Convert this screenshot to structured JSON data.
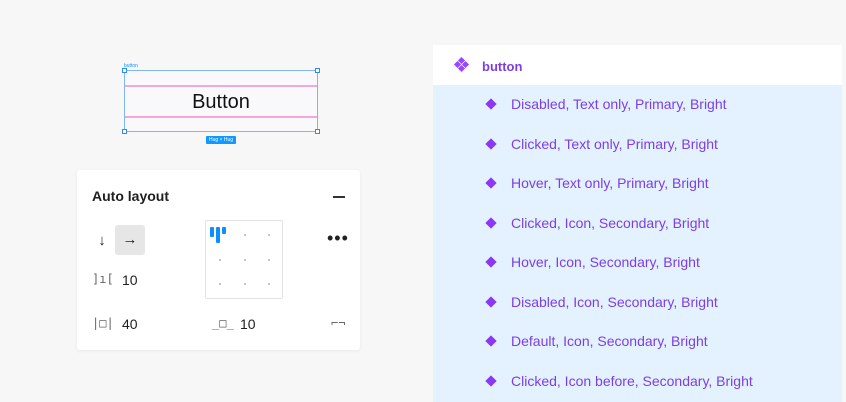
{
  "canvas": {
    "frame_label": "button",
    "button_text": "Button",
    "size_badge": "Hug × Hug"
  },
  "auto_layout": {
    "title": "Auto layout",
    "direction_vertical_icon": "↓",
    "direction_horizontal_icon": "→",
    "spacing_value": "10",
    "horizontal_padding_value": "40",
    "vertical_padding_value": "10",
    "selected_direction": "horizontal",
    "alignment": "top-left"
  },
  "layers": {
    "component_set_name": "button",
    "variants": [
      "Disabled, Text only, Primary, Bright",
      "Clicked, Text only, Primary, Bright",
      "Hover, Text only, Primary, Bright",
      "Clicked, Icon, Secondary, Bright",
      "Hover, Icon, Secondary, Bright",
      "Disabled, Icon, Secondary, Bright",
      "Default, Icon, Secondary, Bright",
      "Clicked, Icon before, Secondary, Bright"
    ]
  },
  "colors": {
    "selection_blue": "#0d99ff",
    "component_purple": "#9747ff",
    "list_highlight": "#e4f2ff",
    "padding_pink": "#f4a7dc"
  }
}
